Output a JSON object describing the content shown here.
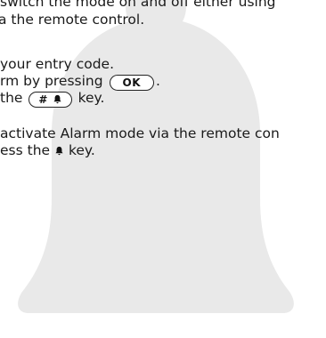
{
  "text": {
    "line1": "switch the mode on and off either using",
    "line2": "a the remote control.",
    "line3": "your entry code.",
    "line4_before": "rm by pressing",
    "line4_after": ".",
    "line5_before": "the",
    "line5_after": "key.",
    "line6": "activate Alarm mode via the remote con",
    "line7_before": "ess the",
    "line7_after": "key."
  },
  "keys": {
    "ok_key": "OK",
    "hash_key": "#"
  },
  "icons": {
    "background": "bell-icon",
    "inline": "alarm-bell-icon"
  },
  "colors": {
    "bell_watermark": "#e9e9e9",
    "text": "#1a1a1a"
  }
}
